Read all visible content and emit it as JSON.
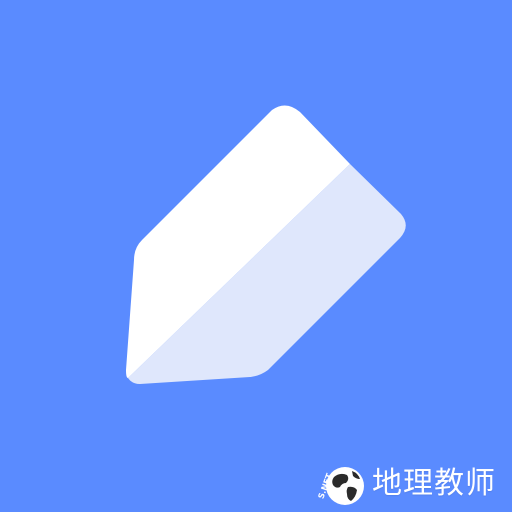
{
  "app_icon": {
    "icon": "pencil-icon",
    "background_color": "#5a8bff",
    "pencil_light_color": "#ffffff",
    "pencil_shade_color": "#dfe7fc"
  },
  "watermark": {
    "logo": "globe-logo",
    "logo_letters": "S.NET",
    "text": "地理教师"
  }
}
